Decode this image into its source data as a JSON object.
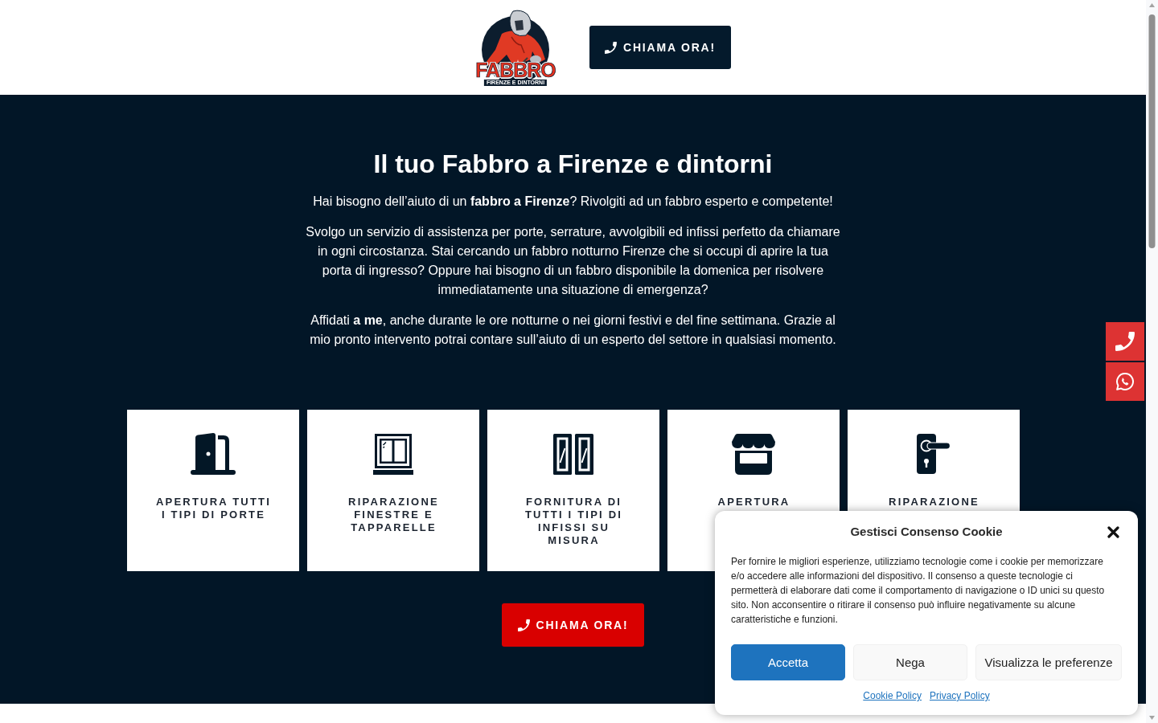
{
  "header": {
    "logo": {
      "wordmark": "FABBRO",
      "tagline": "FIRENZE E DINTORNI"
    },
    "call_button": {
      "label": "CHIAMA ORA!"
    }
  },
  "hero": {
    "title": "Il tuo Fabbro a Firenze e dintorni",
    "paragraphs": [
      "Hai bisogno dell’aiuto di un **fabbro a Firenze**? Rivolgiti ad un fabbro esperto e competente!",
      "Svolgo un servizio di assistenza per porte, serrature, avvolgibili ed infissi perfetto da chiamare in ogni circostanza. Stai cercando un fabbro notturno Firenze che si occupi di aprire la tua porta di ingresso? Oppure hai bisogno di un fabbro disponibile la domenica per risolvere immediatamente una situazione di emergenza?",
      "Affidati **a me**, anche durante le ore notturne o nei giorni festivi e del fine settimana. Grazie al mio pronto intervento potrai contare sull’aiuto di un esperto del settore in qualsiasi momento."
    ]
  },
  "services": [
    {
      "kind": "door",
      "label": "APERTURA TUTTI I TIPI DI PORTE"
    },
    {
      "kind": "window",
      "label": "RIPARAZIONE FINESTRE E TAPPARELLE"
    },
    {
      "kind": "double-window",
      "label": "FORNITURA DI TUTTI I TIPI DI INFISSI SU MISURA"
    },
    {
      "kind": "store",
      "label": "APERTURA"
    },
    {
      "kind": "door-handle",
      "label": "RIPARAZIONE"
    }
  ],
  "cta_button": {
    "label": "CHIAMA ORA!"
  },
  "floating_buttons": [
    {
      "kind": "phone"
    },
    {
      "kind": "chat"
    }
  ],
  "cookie_dialog": {
    "title": "Gestisci Consenso Cookie",
    "text": "Per fornire le migliori esperienze, utilizziamo tecnologie come i cookie per memorizzare e/o accedere alle informazioni del dispositivo. Il consenso a queste tecnologie ci permetterà di elaborare dati come il comportamento di navigazione o ID unici su questo sito. Non acconsentire o ritirare il consenso può influire negativamente su alcune caratteristiche e funzioni.",
    "buttons": [
      {
        "kind": "accept",
        "label": "Accetta"
      },
      {
        "kind": "deny",
        "label": "Nega"
      },
      {
        "kind": "preferences",
        "label": "Visualizza le preferenze"
      }
    ],
    "links": [
      "Cookie Policy",
      "Privacy Policy"
    ]
  }
}
